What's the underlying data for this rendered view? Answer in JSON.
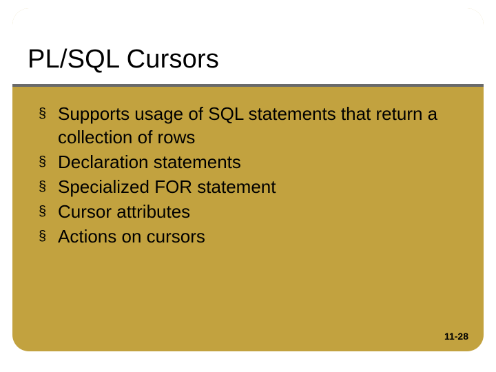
{
  "slide": {
    "title": "PL/SQL Cursors",
    "bullets": [
      "Supports usage of SQL statements that return a collection of rows",
      "Declaration statements",
      "Specialized FOR statement",
      "Cursor attributes",
      "Actions on cursors"
    ],
    "page_number": "11-28",
    "bullet_char": "§"
  }
}
